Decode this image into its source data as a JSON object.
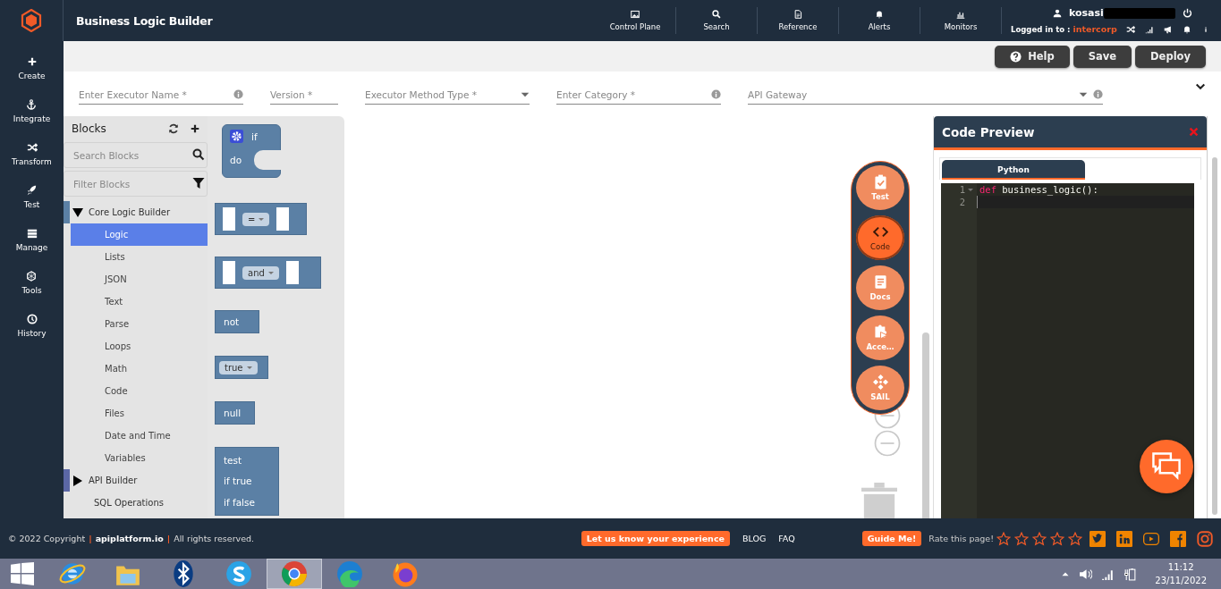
{
  "app": {
    "title": "Business Logic Builder"
  },
  "sidebar": [
    {
      "label": "Create"
    },
    {
      "label": "Integrate"
    },
    {
      "label": "Transform"
    },
    {
      "label": "Test"
    },
    {
      "label": "Manage"
    },
    {
      "label": "Tools"
    },
    {
      "label": "History"
    }
  ],
  "top_nav": [
    {
      "label": "Control Plane"
    },
    {
      "label": "Search"
    },
    {
      "label": "Reference"
    },
    {
      "label": "Alerts"
    },
    {
      "label": "Monitors"
    }
  ],
  "user": {
    "name": "kosasi",
    "logged_in_label": "Logged in to :",
    "tenant": "intercorp"
  },
  "actions": [
    {
      "label": "Help",
      "kind": "help"
    },
    {
      "label": "Save",
      "kind": "plain"
    },
    {
      "label": "Deploy",
      "kind": "plain"
    }
  ],
  "form": [
    {
      "placeholder": "Enter Executor Name *",
      "kind": "info"
    },
    {
      "placeholder": "Version *",
      "kind": "text"
    },
    {
      "placeholder": "Executor Method Type *",
      "kind": "select"
    },
    {
      "placeholder": "Enter Category *",
      "kind": "info"
    },
    {
      "placeholder": "API Gateway",
      "kind": "select-info"
    }
  ],
  "blocks_panel": {
    "title": "Blocks",
    "search": {
      "placeholder": "Search Blocks"
    },
    "filter": {
      "placeholder": "Filter Blocks"
    },
    "tree": [
      {
        "label": "Core Logic Builder",
        "kind": "group",
        "expanded": true,
        "color": "#5b80a5",
        "children": [
          {
            "label": "Logic",
            "selected": true
          },
          {
            "label": "Lists",
            "selected": false
          },
          {
            "label": "JSON",
            "selected": false
          },
          {
            "label": "Text",
            "selected": false
          },
          {
            "label": "Parse",
            "selected": false
          },
          {
            "label": "Loops",
            "selected": false
          },
          {
            "label": "Math",
            "selected": false
          },
          {
            "label": "Code",
            "selected": false
          },
          {
            "label": "Files",
            "selected": false
          },
          {
            "label": "Date and Time",
            "selected": false
          },
          {
            "label": "Variables",
            "selected": false
          }
        ]
      },
      {
        "label": "API Builder",
        "kind": "group",
        "expanded": false,
        "color": "#5b67a5"
      },
      {
        "label": "SQL Operations",
        "kind": "leaf"
      }
    ]
  },
  "flyout": [
    {
      "kind": "if",
      "labels": [
        "if",
        "do"
      ]
    },
    {
      "kind": "compare",
      "operator": "="
    },
    {
      "kind": "operation",
      "operator": "and"
    },
    {
      "kind": "negate",
      "label": "not"
    },
    {
      "kind": "boolean",
      "value": "true"
    },
    {
      "kind": "null",
      "label": "null"
    },
    {
      "kind": "ternary",
      "labels": [
        "test",
        "if true",
        "if false"
      ]
    }
  ],
  "fab_menu": [
    {
      "label": "Test",
      "selected": false
    },
    {
      "label": "Code",
      "selected": true
    },
    {
      "label": "Docs",
      "selected": false
    },
    {
      "label": "Acce…",
      "selected": false
    },
    {
      "label": "SAIL",
      "selected": false
    }
  ],
  "code_preview": {
    "title": "Code Preview",
    "tabs": [
      {
        "label": "Python",
        "selected": true
      }
    ],
    "lines": [
      {
        "number": "1",
        "foldable": true,
        "active": false,
        "tokens": [
          {
            "text": "def",
            "kind": "keyword"
          },
          {
            "text": " business_logic():",
            "kind": "plain"
          }
        ]
      },
      {
        "number": "2",
        "foldable": false,
        "active": true
      }
    ]
  },
  "footer": {
    "copyright": [
      {
        "text": "© 2022 Copyright",
        "kind": "plain"
      },
      {
        "text": "|",
        "kind": "separator"
      },
      {
        "text": "apiplatform.io",
        "kind": "link"
      },
      {
        "text": "|",
        "kind": "separator"
      },
      {
        "text": "All rights reserved.",
        "kind": "plain"
      }
    ],
    "feedback_button": "Let us know your experience",
    "links": [
      "BLOG",
      "FAQ"
    ],
    "guide_button": "Guide Me!",
    "rate_label": "Rate this page!",
    "stars": 0
  },
  "taskbar": {
    "apps": [
      {
        "kind": "ie",
        "selected": false
      },
      {
        "kind": "folder",
        "selected": false
      },
      {
        "kind": "bluetooth",
        "selected": false
      },
      {
        "kind": "skype",
        "selected": false
      },
      {
        "kind": "chrome",
        "selected": true
      },
      {
        "kind": "edge",
        "selected": false
      },
      {
        "kind": "firefox",
        "selected": false
      }
    ],
    "time": "11:12",
    "date": "23/11/2022"
  }
}
